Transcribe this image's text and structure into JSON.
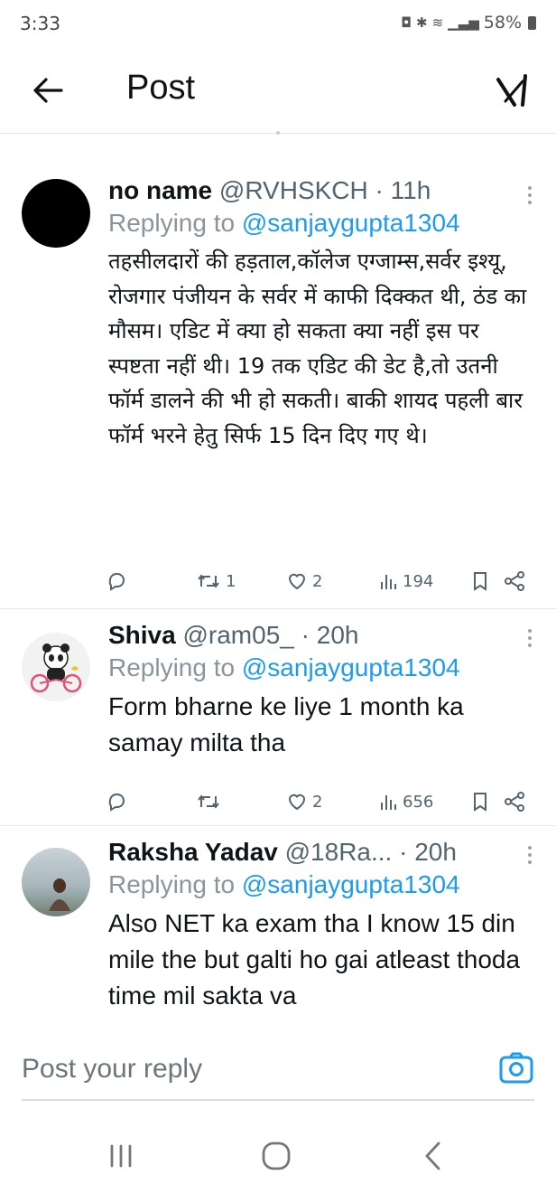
{
  "status_bar": {
    "time": "3:33",
    "battery": "58%"
  },
  "header": {
    "title": "Post"
  },
  "tweets": [
    {
      "name": "no name",
      "handle": "@RVHSKCH",
      "time": "· 11h",
      "replying_prefix": "Replying to",
      "replying_to": "@sanjaygupta1304",
      "text": "तहसीलदारों की हड़ताल,कॉलेज एग्जाम्स,सर्वर इश्यू, रोजगार पंजीयन के सर्वर में काफी दिक्कत थी, ठंड का  मौसम। एडिट में क्या हो सकता क्या नहीं इस पर स्पष्टता नहीं थी। 19 तक एडिट की डेट है,तो उतनी फॉर्म डालने की भी हो सकती। बाकी शायद पहली बार फॉर्म भरने हेतु सिर्फ 15 दिन दिए गए थे।",
      "retweets": "1",
      "likes": "2",
      "views": "194"
    },
    {
      "name": "Shiva",
      "handle": "@ram05_",
      "time": "· 20h",
      "replying_prefix": "Replying to",
      "replying_to": "@sanjaygupta1304",
      "text": "Form bharne ke liye 1 month ka samay milta tha",
      "retweets": "",
      "likes": "2",
      "views": "656"
    },
    {
      "name": "Raksha Yadav",
      "handle": "@18Ra...",
      "time": "· 20h",
      "replying_prefix": "Replying to",
      "replying_to": "@sanjaygupta1304",
      "text": "Also NET ka exam tha I know 15 din mile the but galti ho gai atleast thoda time mil sakta va"
    }
  ],
  "reply_bar": {
    "placeholder": "Post your reply"
  },
  "colors": {
    "mention": "#1d9bf0",
    "text": "#0f1419",
    "muted": "#536471"
  },
  "icons": [
    "back-arrow-icon",
    "grok-icon",
    "more-icon",
    "reply-icon",
    "retweet-icon",
    "like-icon",
    "views-icon",
    "bookmark-icon",
    "share-icon",
    "camera-icon",
    "recents-icon",
    "home-icon",
    "nav-back-icon"
  ]
}
